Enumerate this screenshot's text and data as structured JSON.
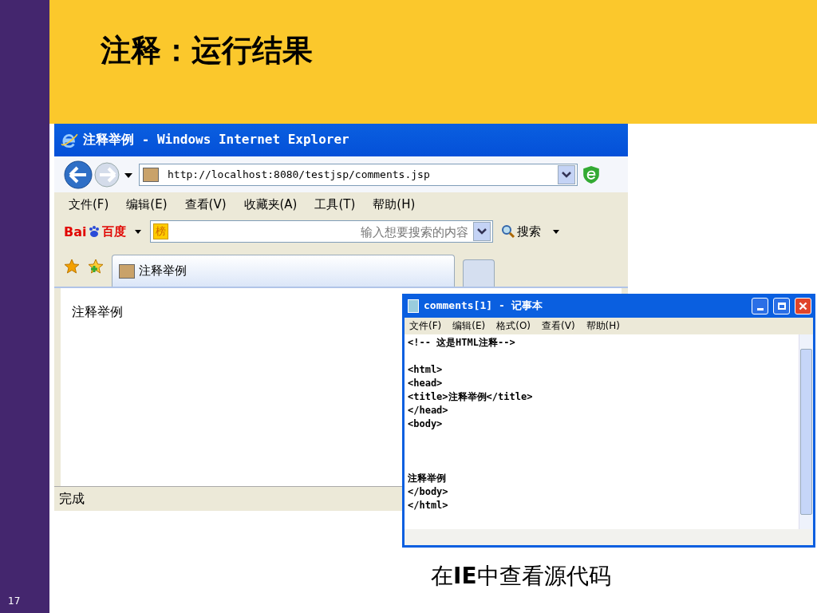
{
  "slide": {
    "title": "注释：运行结果",
    "caption": "在**IE**中查看源代码",
    "page_number": "17"
  },
  "browser": {
    "title": "注释举例 - Windows Internet Explorer",
    "address": "http://localhost:8080/testjsp/comments.jsp",
    "menu": [
      "文件(F)",
      "编辑(E)",
      "查看(V)",
      "收藏夹(A)",
      "工具(T)",
      "帮助(H)"
    ],
    "search": {
      "logo_latin": "Bai",
      "logo_cjk": "百度",
      "badge": "榜",
      "placeholder": "输入想要搜索的内容",
      "button": "搜索"
    },
    "tabs": [
      {
        "label": "注释举例",
        "selected": true
      }
    ],
    "content": "注释举例",
    "status": "完成"
  },
  "notepad": {
    "title": "comments[1] - 记事本",
    "menu": [
      "文件(F)",
      "编辑(E)",
      "格式(O)",
      "查看(V)",
      "帮助(H)"
    ],
    "blocks": [
      [
        "<!-- 这是HTML注释-->"
      ],
      [
        "<html>",
        "<head>",
        "<title>注释举例</title>",
        "</head>",
        "<body>"
      ],
      [
        "注释举例",
        "</body>",
        "</html>"
      ]
    ]
  }
}
